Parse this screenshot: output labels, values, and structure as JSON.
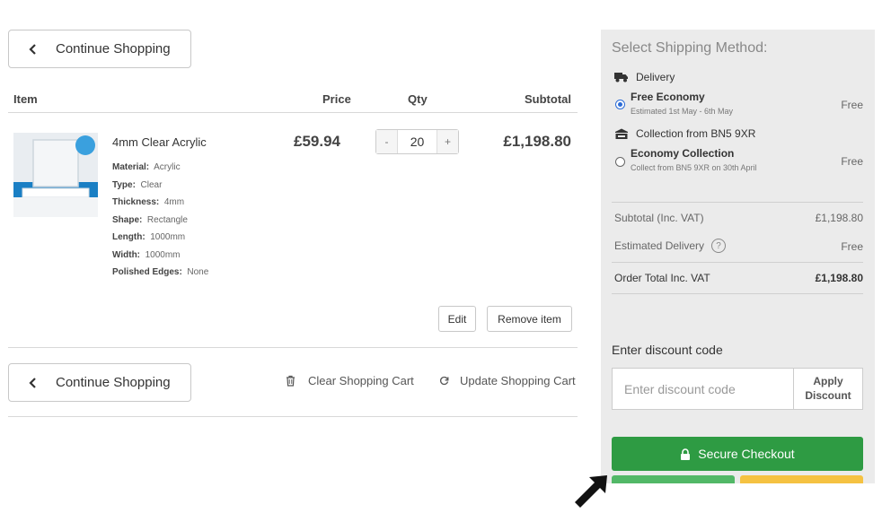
{
  "cart": {
    "continue_label": "Continue Shopping",
    "headers": {
      "item": "Item",
      "price": "Price",
      "qty": "Qty",
      "subtotal": "Subtotal"
    },
    "item": {
      "name": "4mm Clear Acrylic",
      "attributes": [
        {
          "label": "Material:",
          "value": "Acrylic"
        },
        {
          "label": "Type:",
          "value": "Clear"
        },
        {
          "label": "Thickness:",
          "value": "4mm"
        },
        {
          "label": "Shape:",
          "value": "Rectangle"
        },
        {
          "label": "Length:",
          "value": "1000mm"
        },
        {
          "label": "Width:",
          "value": "1000mm"
        },
        {
          "label": "Polished Edges:",
          "value": "None"
        }
      ],
      "price": "£59.94",
      "qty": "20",
      "qty_minus": "-",
      "qty_plus": "+",
      "subtotal": "£1,198.80"
    },
    "edit_label": "Edit",
    "remove_label": "Remove item",
    "clear_label": "Clear Shopping Cart",
    "update_label": "Update Shopping Cart"
  },
  "shipping": {
    "title": "Select Shipping Method:",
    "delivery_label": "Delivery",
    "free_economy": {
      "title": "Free Economy",
      "sub": "Estimated 1st May - 6th May",
      "price": "Free",
      "selected": true
    },
    "collection_label": "Collection from BN5 9XR",
    "economy_collection": {
      "title": "Economy Collection",
      "sub": "Collect from BN5 9XR on 30th April",
      "price": "Free",
      "selected": false
    }
  },
  "summary": {
    "subtotal_label": "Subtotal (Inc. VAT)",
    "subtotal_value": "£1,198.80",
    "delivery_label": "Estimated Delivery",
    "delivery_help": "?",
    "delivery_value": "Free",
    "total_label": "Order Total Inc. VAT",
    "total_value": "£1,198.80"
  },
  "discount": {
    "label": "Enter discount code",
    "placeholder": "Enter discount code",
    "apply_line1": "Apply",
    "apply_line2": "Discount"
  },
  "checkout": {
    "label": "Secure Checkout"
  },
  "colors": {
    "checkout_green": "#2e9b43",
    "paypal_yellow": "#f5c242",
    "radio_blue": "#2b6bd6"
  }
}
